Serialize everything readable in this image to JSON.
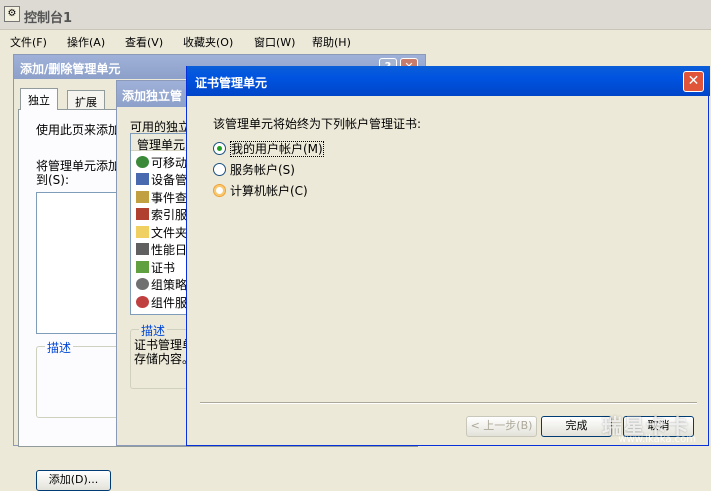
{
  "main_window": {
    "title": "控制台1",
    "menu": [
      "文件(F)",
      "操作(A)",
      "查看(V)",
      "收藏夹(O)",
      "窗口(W)",
      "帮助(H)"
    ]
  },
  "add_remove_dialog": {
    "title": "添加/删除管理单元",
    "tabs": [
      "独立",
      "扩展"
    ],
    "intro": "使用此页来添加",
    "add_to_label_line1": "将管理单元添加",
    "add_to_label_line2": "到(S):",
    "description_label": "描述",
    "add_button": "添加(D)..."
  },
  "add_standalone_dialog": {
    "title": "添加独立管",
    "available_label": "可用的独立",
    "column_header": "管理单元",
    "items": [
      {
        "label": "可移动",
        "icon": "removable-storage-icon"
      },
      {
        "label": "设备管",
        "icon": "device-manager-icon"
      },
      {
        "label": "事件查",
        "icon": "event-viewer-icon"
      },
      {
        "label": "索引服",
        "icon": "indexing-service-icon"
      },
      {
        "label": "文件夹",
        "icon": "folder-icon"
      },
      {
        "label": "性能日",
        "icon": "performance-logs-icon"
      },
      {
        "label": "证书",
        "icon": "certificate-icon"
      },
      {
        "label": "组策略",
        "icon": "group-policy-icon"
      },
      {
        "label": "组件服",
        "icon": "component-services-icon"
      }
    ],
    "description_label": "描述",
    "description_line1": "证书管理单",
    "description_line2": "存储内容。"
  },
  "cert_dialog": {
    "title": "证书管理单元",
    "prompt": "该管理单元将始终为下列帐户管理证书:",
    "options": [
      {
        "label": "我的用户帐户(M)",
        "selected": true
      },
      {
        "label": "服务帐户(S)",
        "selected": false
      },
      {
        "label": "计算机帐户(C)",
        "selected": false
      }
    ],
    "back_button": "< 上一步(B)",
    "finish_button": "完成",
    "cancel_button": "取消"
  },
  "watermark": {
    "main": "瑞星卡卡",
    "url": "www.ikaka.com"
  },
  "colors": {
    "xp_blue": "#0053e0",
    "close_red": "#e0553a",
    "dialog_bg": "#ece9d8"
  }
}
